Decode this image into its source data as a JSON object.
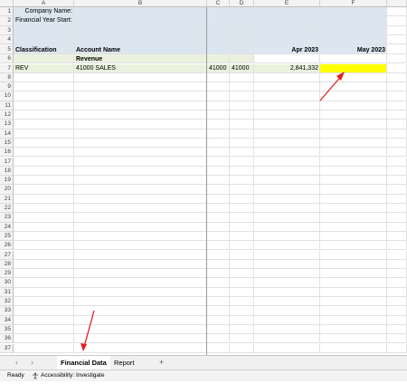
{
  "columns": [
    "A",
    "B",
    "C",
    "D",
    "E",
    "F"
  ],
  "rows": [
    "1",
    "2",
    "3",
    "4",
    "5",
    "6",
    "7",
    "8",
    "9",
    "10",
    "11",
    "12",
    "13",
    "14",
    "15",
    "16",
    "17",
    "18",
    "19",
    "20",
    "21",
    "22",
    "23",
    "24",
    "25",
    "26",
    "27",
    "28",
    "29",
    "30",
    "31",
    "32",
    "33",
    "34",
    "35",
    "36",
    "37"
  ],
  "header_block": {
    "company_label": "Company Name:",
    "year_label": "Financial Year Start:"
  },
  "table_headers": {
    "classification": "Classification",
    "account_name": "Account Name",
    "apr": "Apr 2023",
    "may": "May 2023"
  },
  "section": {
    "label": "Revenue"
  },
  "data_row": {
    "classification": "REV",
    "account_name": "41000 SALES",
    "code_c": "41000",
    "code_d": "41000",
    "apr_value": "2,841,332",
    "may_value": ""
  },
  "colors": {
    "header_fill": "#dce6f1",
    "section_fill": "#ebf1de",
    "highlight_fill": "#ffff00",
    "arrow_color": "#e02020",
    "active_tab_underline": "#217346"
  },
  "tabs": {
    "prev_icon": "chevron-left-icon",
    "next_icon": "chevron-right-icon",
    "items": [
      "Financial Data",
      "Report"
    ],
    "active": "Financial Data",
    "add_label": "+"
  },
  "status": {
    "ready": "Ready",
    "accessibility": "Accessibility: Investigate",
    "accessibility_icon": "accessibility-icon"
  }
}
